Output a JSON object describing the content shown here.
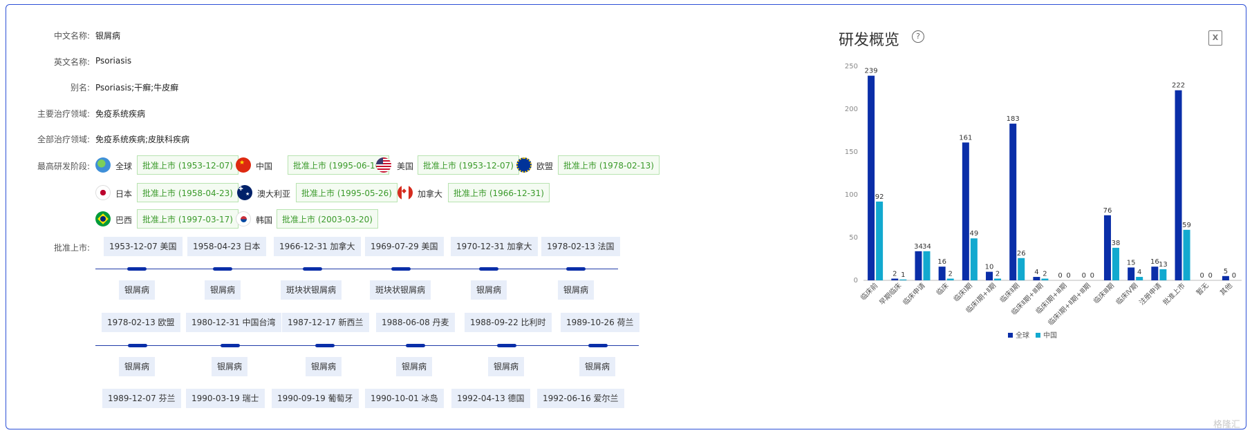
{
  "info": {
    "cn_name_label": "中文名称:",
    "cn_name": "银屑病",
    "en_name_label": "英文名称:",
    "en_name": "Psoriasis",
    "alias_label": "别名:",
    "alias": "Psoriasis;干癣;牛皮癣",
    "main_area_label": "主要治疗领域:",
    "main_area": "免疫系统疾病",
    "all_area_label": "全部治疗领域:",
    "all_area": "免疫系统疾病;皮肤科疾病",
    "highest_stage_label": "最高研发阶段:",
    "approved_label": "批准上市:"
  },
  "stages": [
    {
      "country": "全球",
      "icon": "globe-icon",
      "stage": "批准上市 (1953-12-07)"
    },
    {
      "country": "中国",
      "icon": "china-flag-icon",
      "stage": "批准上市 (1995-06-16)"
    },
    {
      "country": "美国",
      "icon": "usa-flag-icon",
      "stage": "批准上市 (1953-12-07)"
    },
    {
      "country": "欧盟",
      "icon": "eu-flag-icon",
      "stage": "批准上市 (1978-02-13)"
    },
    {
      "country": "日本",
      "icon": "japan-flag-icon",
      "stage": "批准上市 (1958-04-23)"
    },
    {
      "country": "澳大利亚",
      "icon": "australia-flag-icon",
      "stage": "批准上市 (1995-05-26)"
    },
    {
      "country": "加拿大",
      "icon": "canada-flag-icon",
      "stage": "批准上市 (1966-12-31)"
    },
    {
      "country": "巴西",
      "icon": "brazil-flag-icon",
      "stage": "批准上市 (1997-03-17)"
    },
    {
      "country": "韩国",
      "icon": "korea-flag-icon",
      "stage": "批准上市 (2003-03-20)"
    }
  ],
  "timeline": [
    {
      "items": [
        {
          "date": "1953-12-07 美国",
          "disease": "银屑病"
        },
        {
          "date": "1958-04-23 日本",
          "disease": "银屑病"
        },
        {
          "date": "1966-12-31 加拿大",
          "disease": "斑块状银屑病"
        },
        {
          "date": "1969-07-29 美国",
          "disease": "斑块状银屑病"
        },
        {
          "date": "1970-12-31 加拿大",
          "disease": "银屑病"
        },
        {
          "date": "1978-02-13 法国",
          "disease": "银屑病"
        }
      ]
    },
    {
      "items": [
        {
          "date": "1978-02-13 欧盟",
          "disease": "银屑病"
        },
        {
          "date": "1980-12-31 中国台湾",
          "disease": "银屑病"
        },
        {
          "date": "1987-12-17 新西兰",
          "disease": "银屑病"
        },
        {
          "date": "1988-06-08 丹麦",
          "disease": "银屑病"
        },
        {
          "date": "1988-09-22 比利时",
          "disease": "银屑病"
        },
        {
          "date": "1989-10-26 荷兰",
          "disease": "银屑病"
        }
      ]
    },
    {
      "items": [
        {
          "date": "1989-12-07 芬兰"
        },
        {
          "date": "1990-03-19 瑞士"
        },
        {
          "date": "1990-09-19 葡萄牙"
        },
        {
          "date": "1990-10-01 冰岛"
        },
        {
          "date": "1992-04-13 德国"
        },
        {
          "date": "1992-06-16 爱尔兰"
        }
      ]
    }
  ],
  "chart_panel": {
    "title": "研发概览",
    "help_icon": "help-circle-icon",
    "export_icon": "excel-export-icon",
    "export_glyph": "X"
  },
  "chart_data": {
    "type": "bar",
    "categories": [
      "临床前",
      "早期临床",
      "临床申请",
      "临床",
      "临床Ⅰ期",
      "临床Ⅰ期+Ⅱ期",
      "临床Ⅱ期",
      "临床Ⅱ期+Ⅲ期",
      "临床Ⅰ期+Ⅲ期",
      "临床Ⅰ期+Ⅱ期+Ⅲ期",
      "临床Ⅲ期",
      "临床Ⅳ期",
      "注册申请",
      "批准上市",
      "暂无",
      "其他"
    ],
    "series": [
      {
        "name": "全球",
        "color": "#0a2ea8",
        "values": [
          239,
          2,
          34,
          16,
          161,
          10,
          183,
          4,
          0,
          0,
          76,
          15,
          16,
          222,
          0,
          5
        ]
      },
      {
        "name": "中国",
        "color": "#12a9cf",
        "values": [
          92,
          1,
          34,
          2,
          49,
          2,
          26,
          2,
          0,
          0,
          38,
          4,
          13,
          59,
          0,
          0
        ]
      }
    ],
    "ylim": [
      0,
      250
    ],
    "yticks": [
      0,
      50,
      100,
      150,
      200,
      250
    ],
    "grid": false,
    "legend": "bottom"
  },
  "watermark": "格隆汇"
}
